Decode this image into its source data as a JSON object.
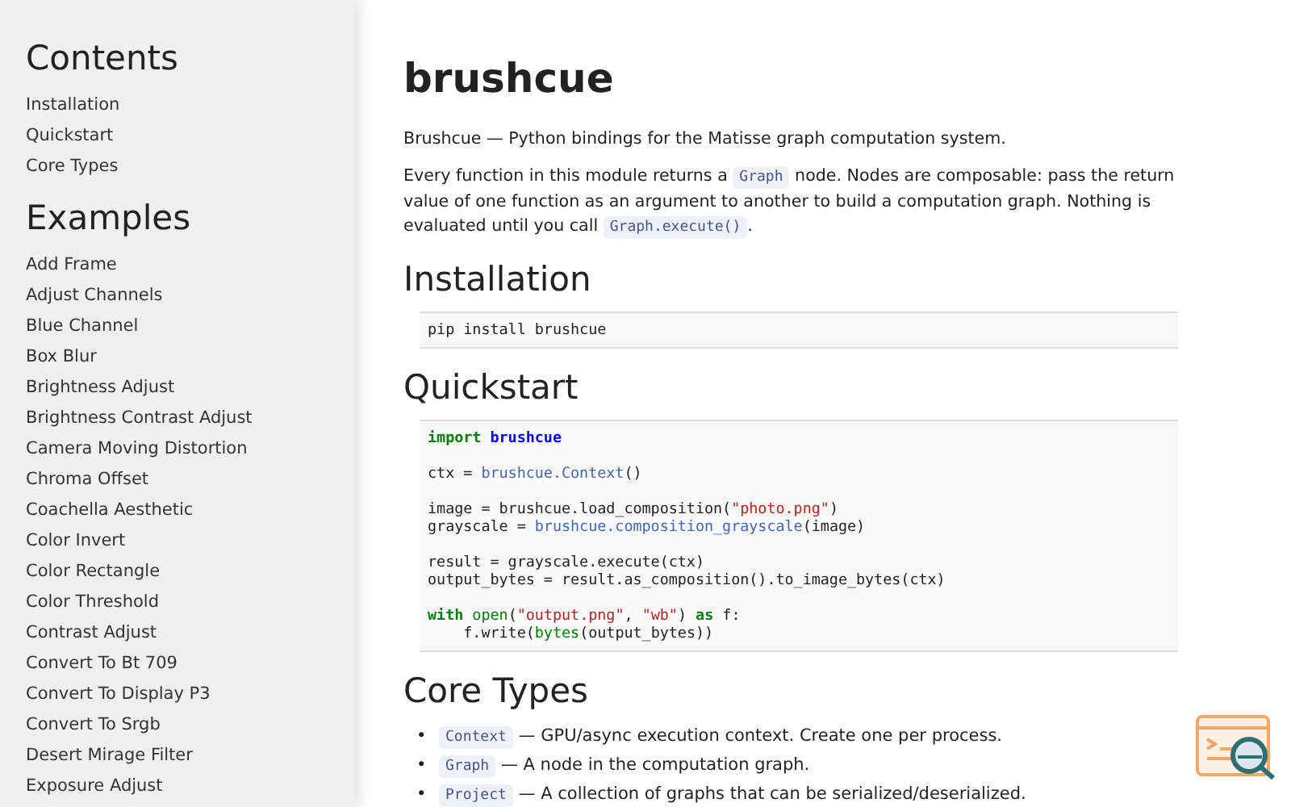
{
  "sidebar": {
    "sections": [
      {
        "title": "Contents",
        "items": [
          "Installation",
          "Quickstart",
          "Core Types"
        ]
      },
      {
        "title": "Examples",
        "items": [
          "Add Frame",
          "Adjust Channels",
          "Blue Channel",
          "Box Blur",
          "Brightness Adjust",
          "Brightness Contrast Adjust",
          "Camera Moving Distortion",
          "Chroma Offset",
          "Coachella Aesthetic",
          "Color Invert",
          "Color Rectangle",
          "Color Threshold",
          "Contrast Adjust",
          "Convert To Bt 709",
          "Convert To Display P3",
          "Convert To Srgb",
          "Desert Mirage Filter",
          "Exposure Adjust"
        ]
      }
    ]
  },
  "main": {
    "title": "brushcue",
    "intro": "Brushcue — Python bindings for the Matisse graph computation system.",
    "paragraph": [
      {
        "kind": "text",
        "text": "Every function in this module returns a "
      },
      {
        "kind": "code",
        "text": "Graph"
      },
      {
        "kind": "text",
        "text": " node. Nodes are composable: pass the return value of one function as an argument to another to build a computation graph. Nothing is evaluated until you call "
      },
      {
        "kind": "code",
        "text": "Graph.execute()"
      },
      {
        "kind": "text",
        "text": "."
      }
    ],
    "installation": {
      "heading": "Installation",
      "code": [
        [
          [
            {
              "kind": "plain",
              "text": "pip install brushcue"
            }
          ]
        ]
      ]
    },
    "quickstart": {
      "heading": "Quickstart",
      "code": [
        [
          [
            {
              "kind": "keyword",
              "text": "import"
            },
            {
              "kind": "module",
              "text": " brushcue"
            }
          ]
        ],
        [
          [
            {
              "kind": "plain",
              "text": "ctx = "
            },
            {
              "kind": "name",
              "text": "brushcue.Context"
            },
            {
              "kind": "plain",
              "text": "()"
            }
          ]
        ],
        [
          [
            {
              "kind": "plain",
              "text": "image = brushcue.load_composition("
            },
            {
              "kind": "string",
              "text": "\"photo.png\""
            },
            {
              "kind": "plain",
              "text": ")"
            }
          ],
          [
            {
              "kind": "plain",
              "text": "grayscale = "
            },
            {
              "kind": "name",
              "text": "brushcue.composition_grayscale"
            },
            {
              "kind": "plain",
              "text": "(image)"
            }
          ]
        ],
        [
          [
            {
              "kind": "plain",
              "text": "result = grayscale.execute(ctx)"
            }
          ],
          [
            {
              "kind": "plain",
              "text": "output_bytes = result.as_composition().to_image_bytes(ctx)"
            }
          ]
        ],
        [
          [
            {
              "kind": "keyword",
              "text": "with"
            },
            {
              "kind": "builtin",
              "text": " open"
            },
            {
              "kind": "plain",
              "text": "("
            },
            {
              "kind": "string",
              "text": "\"output.png\""
            },
            {
              "kind": "plain",
              "text": ", "
            },
            {
              "kind": "string",
              "text": "\"wb\""
            },
            {
              "kind": "plain",
              "text": ") "
            },
            {
              "kind": "keyword",
              "text": "as"
            },
            {
              "kind": "plain",
              "text": " f:"
            }
          ],
          [
            {
              "kind": "plain",
              "text": "    f.write("
            },
            {
              "kind": "builtin",
              "text": "bytes"
            },
            {
              "kind": "plain",
              "text": "(output_bytes))"
            }
          ]
        ]
      ]
    },
    "core_types": {
      "heading": "Core Types",
      "items": [
        {
          "marker": "•",
          "code": "Context",
          "text": "— GPU/async execution context. Create one per process."
        },
        {
          "marker": "•",
          "code": "Graph",
          "text": "— A node in the computation graph."
        },
        {
          "marker": "•",
          "code": "Project",
          "text": "— A collection of graphs that can be serialized/deserialized."
        }
      ]
    }
  }
}
